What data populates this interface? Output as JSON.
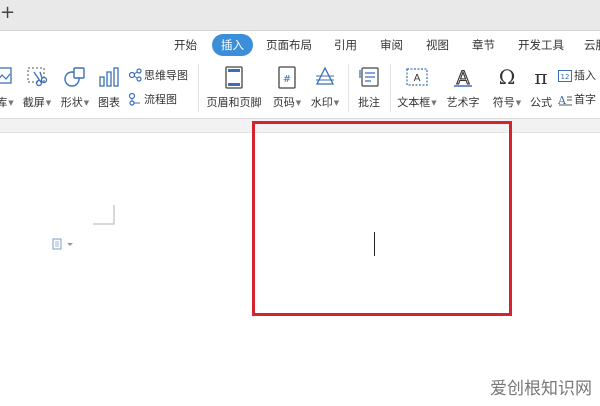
{
  "topbar": {
    "new_tab_glyph": "+"
  },
  "tabs": [
    {
      "label": "开始"
    },
    {
      "label": "插入"
    },
    {
      "label": "页面布局"
    },
    {
      "label": "引用"
    },
    {
      "label": "审阅"
    },
    {
      "label": "视图"
    },
    {
      "label": "章节"
    },
    {
      "label": "开发工具"
    },
    {
      "label": "云服"
    }
  ],
  "active_tab": "插入",
  "ribbon": {
    "left_partial": {
      "label": "库"
    },
    "screenshot": {
      "label": "截屏"
    },
    "shapes": {
      "label": "形状"
    },
    "chart": {
      "label": "图表"
    },
    "mindmap": {
      "label": "思维导图"
    },
    "flowchart": {
      "label": "流程图"
    },
    "header_footer": {
      "label": "页眉和页脚"
    },
    "page_number": {
      "label": "页码"
    },
    "watermark": {
      "label": "水印"
    },
    "comment": {
      "label": "批注"
    },
    "textbox": {
      "label": "文本框"
    },
    "wordart": {
      "label": "艺术字"
    },
    "symbol": {
      "label": "符号"
    },
    "formula": {
      "label": "公式"
    },
    "insert_number": {
      "label": "插入"
    },
    "drop_cap": {
      "label": "首字"
    }
  },
  "watermark_text": "爱创根知识网",
  "colors": {
    "active_tab": "#3b8fd9",
    "highlight_box": "#d4232d",
    "topbar": "#e9e9e9"
  }
}
